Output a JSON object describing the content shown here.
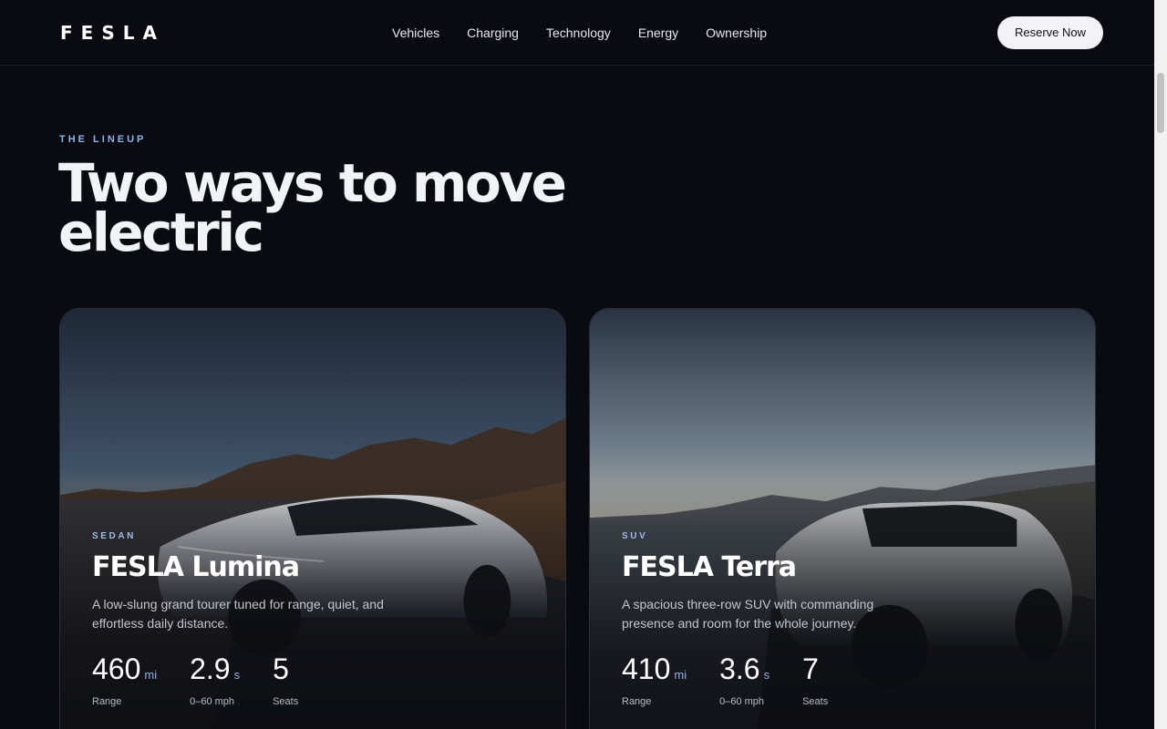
{
  "brand": {
    "logo": "FESLA"
  },
  "nav": {
    "links": [
      "Vehicles",
      "Charging",
      "Technology",
      "Energy",
      "Ownership"
    ],
    "cta": "Reserve Now"
  },
  "hero": {
    "eyebrow": "THE LINEUP",
    "title": "Two ways to move electric"
  },
  "cards": [
    {
      "tag": "SEDAN",
      "title": "FESLA Lumina",
      "description": "A low-slung grand tourer tuned for range, quiet, and effortless daily distance.",
      "stats": [
        {
          "value": "460",
          "unit": "mi",
          "label": "Range"
        },
        {
          "value": "2.9",
          "unit": "s",
          "label": "0–60 mph"
        },
        {
          "value": "5",
          "unit": "",
          "label": "Seats"
        }
      ],
      "actions": {
        "primary": "",
        "secondary": ""
      }
    },
    {
      "tag": "SUV",
      "title": "FESLA Terra",
      "description": "A spacious three-row SUV with commanding presence and room for the whole journey.",
      "stats": [
        {
          "value": "410",
          "unit": "mi",
          "label": "Range"
        },
        {
          "value": "3.6",
          "unit": "s",
          "label": "0–60 mph"
        },
        {
          "value": "7",
          "unit": "",
          "label": "Seats"
        }
      ],
      "actions": {
        "primary": "",
        "secondary": ""
      }
    }
  ],
  "colors": {
    "background": "#0a0b10",
    "accent": "#8fb3ea",
    "button": "#f3f3f5"
  }
}
